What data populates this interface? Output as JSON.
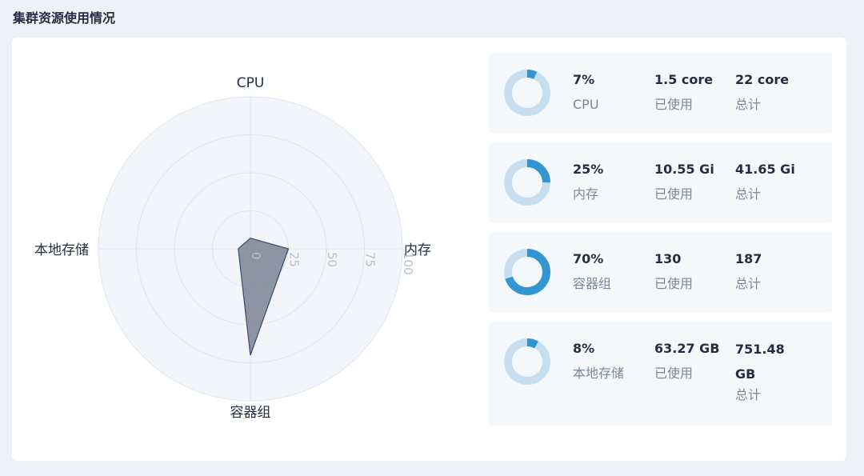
{
  "page": {
    "title": "集群资源使用情况"
  },
  "colors": {
    "accent": "#3396d3",
    "track": "#c7deef",
    "radar_fill": "#7b8494",
    "radar_stroke": "#3a4a6b",
    "radar_bg": "#f2f6fa",
    "grid": "#dfe6ec"
  },
  "chart_data": {
    "type": "radar",
    "axes": [
      "CPU",
      "内存",
      "容器组",
      "本地存储"
    ],
    "values": [
      7,
      25,
      70,
      8
    ],
    "range": [
      0,
      100
    ],
    "ticks": [
      "0",
      "25",
      "50",
      "75",
      "100"
    ]
  },
  "stats": [
    {
      "percent_value": 7,
      "percent": "7%",
      "name": "CPU",
      "used": "1.5 core",
      "used_label": "已使用",
      "total": "22 core",
      "total_label": "总计",
      "icon": "cpu-usage-donut-icon"
    },
    {
      "percent_value": 25,
      "percent": "25%",
      "name": "内存",
      "used": "10.55 Gi",
      "used_label": "已使用",
      "total": "41.65 Gi",
      "total_label": "总计",
      "icon": "memory-usage-donut-icon"
    },
    {
      "percent_value": 70,
      "percent": "70%",
      "name": "容器组",
      "used": "130",
      "used_label": "已使用",
      "total": "187",
      "total_label": "总计",
      "icon": "pod-usage-donut-icon"
    },
    {
      "percent_value": 8,
      "percent": "8%",
      "name": "本地存储",
      "used": "63.27 GB",
      "used_label": "已使用",
      "total": "751.48 GB",
      "total_label": "总计",
      "icon": "storage-usage-donut-icon"
    }
  ]
}
